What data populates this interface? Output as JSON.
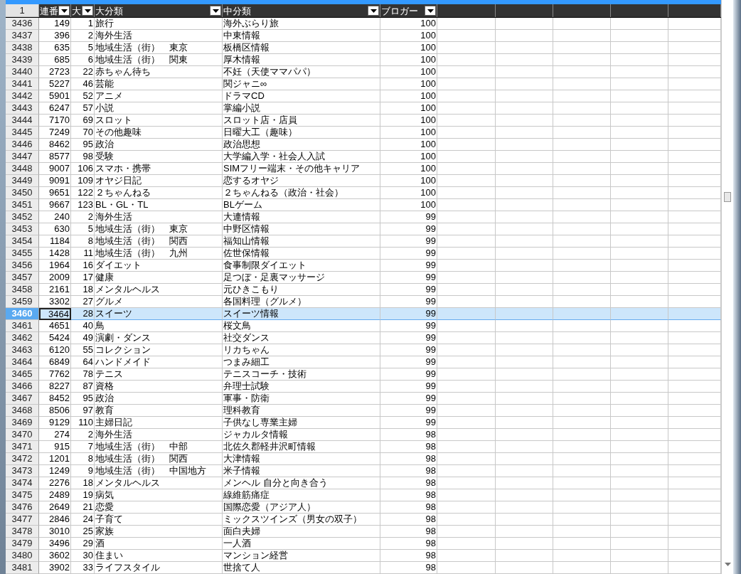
{
  "sheet": {
    "corner": "1",
    "columns": [
      {
        "label": "連番",
        "filter": true
      },
      {
        "label": "大",
        "filter": true
      },
      {
        "label": "大分類",
        "filter": true
      },
      {
        "label": "中分類",
        "filter": true
      },
      {
        "label": "ブロガー",
        "filter": true
      }
    ],
    "rows": [
      {
        "number": "3436",
        "cells": [
          "149",
          "1",
          "旅行",
          "海外ぶらり旅",
          "100"
        ],
        "selected": false
      },
      {
        "number": "3437",
        "cells": [
          "396",
          "2",
          "海外生活",
          "中東情報",
          "100"
        ],
        "selected": false
      },
      {
        "number": "3438",
        "cells": [
          "635",
          "5",
          "地域生活（街）　東京",
          "板橋区情報",
          "100"
        ],
        "selected": false
      },
      {
        "number": "3439",
        "cells": [
          "685",
          "6",
          "地域生活（街）　関東",
          "厚木情報",
          "100"
        ],
        "selected": false
      },
      {
        "number": "3440",
        "cells": [
          "2723",
          "22",
          "赤ちゃん待ち",
          "不妊（天使ママパパ）",
          "100"
        ],
        "selected": false
      },
      {
        "number": "3441",
        "cells": [
          "5227",
          "46",
          "芸能",
          "関ジャニ∞",
          "100"
        ],
        "selected": false
      },
      {
        "number": "3442",
        "cells": [
          "5901",
          "52",
          "アニメ",
          "ドラマCD",
          "100"
        ],
        "selected": false
      },
      {
        "number": "3443",
        "cells": [
          "6247",
          "57",
          "小説",
          "掌編小説",
          "100"
        ],
        "selected": false
      },
      {
        "number": "3444",
        "cells": [
          "7170",
          "69",
          "スロット",
          "スロット店・店員",
          "100"
        ],
        "selected": false
      },
      {
        "number": "3445",
        "cells": [
          "7249",
          "70",
          "その他趣味",
          "日曜大工（趣味）",
          "100"
        ],
        "selected": false
      },
      {
        "number": "3446",
        "cells": [
          "8462",
          "95",
          "政治",
          "政治思想",
          "100"
        ],
        "selected": false
      },
      {
        "number": "3447",
        "cells": [
          "8577",
          "98",
          "受験",
          "大学編入学・社会人入試",
          "100"
        ],
        "selected": false
      },
      {
        "number": "3448",
        "cells": [
          "9007",
          "106",
          "スマホ・携帯",
          "SIMフリー端末・その他キャリア",
          "100"
        ],
        "selected": false
      },
      {
        "number": "3449",
        "cells": [
          "9091",
          "109",
          "オヤジ日記",
          "恋するオヤジ",
          "100"
        ],
        "selected": false
      },
      {
        "number": "3450",
        "cells": [
          "9651",
          "122",
          "２ちゃんねる",
          "２ちゃんねる（政治・社会）",
          "100"
        ],
        "selected": false
      },
      {
        "number": "3451",
        "cells": [
          "9667",
          "123",
          "BL・GL・TL",
          "BLゲーム",
          "100"
        ],
        "selected": false
      },
      {
        "number": "3452",
        "cells": [
          "240",
          "2",
          "海外生活",
          "大連情報",
          "99"
        ],
        "selected": false
      },
      {
        "number": "3453",
        "cells": [
          "630",
          "5",
          "地域生活（街）　東京",
          "中野区情報",
          "99"
        ],
        "selected": false
      },
      {
        "number": "3454",
        "cells": [
          "1184",
          "8",
          "地域生活（街）　関西",
          "福知山情報",
          "99"
        ],
        "selected": false
      },
      {
        "number": "3455",
        "cells": [
          "1428",
          "11",
          "地域生活（街）　九州",
          "佐世保情報",
          "99"
        ],
        "selected": false
      },
      {
        "number": "3456",
        "cells": [
          "1964",
          "16",
          "ダイエット",
          "食事制限ダイエット",
          "99"
        ],
        "selected": false
      },
      {
        "number": "3457",
        "cells": [
          "2009",
          "17",
          "健康",
          "足つぼ・足裏マッサージ",
          "99"
        ],
        "selected": false
      },
      {
        "number": "3458",
        "cells": [
          "2161",
          "18",
          "メンタルヘルス",
          "元ひきこもり",
          "99"
        ],
        "selected": false
      },
      {
        "number": "3459",
        "cells": [
          "3302",
          "27",
          "グルメ",
          "各国料理（グルメ）",
          "99"
        ],
        "selected": false
      },
      {
        "number": "3460",
        "cells": [
          "3464",
          "28",
          "スイーツ",
          "スイーツ情報",
          "99"
        ],
        "selected": true
      },
      {
        "number": "3461",
        "cells": [
          "4651",
          "40",
          "鳥",
          "桜文鳥",
          "99"
        ],
        "selected": false
      },
      {
        "number": "3462",
        "cells": [
          "5424",
          "49",
          "演劇・ダンス",
          "社交ダンス",
          "99"
        ],
        "selected": false
      },
      {
        "number": "3463",
        "cells": [
          "6120",
          "55",
          "コレクション",
          "リカちゃん",
          "99"
        ],
        "selected": false
      },
      {
        "number": "3464",
        "cells": [
          "6849",
          "64",
          "ハンドメイド",
          "つまみ細工",
          "99"
        ],
        "selected": false
      },
      {
        "number": "3465",
        "cells": [
          "7762",
          "78",
          "テニス",
          "テニスコーチ・技術",
          "99"
        ],
        "selected": false
      },
      {
        "number": "3466",
        "cells": [
          "8227",
          "87",
          "資格",
          "弁理士試験",
          "99"
        ],
        "selected": false
      },
      {
        "number": "3467",
        "cells": [
          "8452",
          "95",
          "政治",
          "軍事・防衛",
          "99"
        ],
        "selected": false
      },
      {
        "number": "3468",
        "cells": [
          "8506",
          "97",
          "教育",
          "理科教育",
          "99"
        ],
        "selected": false
      },
      {
        "number": "3469",
        "cells": [
          "9129",
          "110",
          "主婦日記",
          "子供なし専業主婦",
          "99"
        ],
        "selected": false
      },
      {
        "number": "3470",
        "cells": [
          "274",
          "2",
          "海外生活",
          "ジャカルタ情報",
          "98"
        ],
        "selected": false
      },
      {
        "number": "3471",
        "cells": [
          "915",
          "7",
          "地域生活（街）　中部",
          "北佐久郡軽井沢町情報",
          "98"
        ],
        "selected": false
      },
      {
        "number": "3472",
        "cells": [
          "1201",
          "8",
          "地域生活（街）　関西",
          "大津情報",
          "98"
        ],
        "selected": false
      },
      {
        "number": "3473",
        "cells": [
          "1249",
          "9",
          "地域生活（街）　中国地方",
          "米子情報",
          "98"
        ],
        "selected": false
      },
      {
        "number": "3474",
        "cells": [
          "2276",
          "18",
          "メンタルヘルス",
          "メンヘル 自分と向き合う",
          "98"
        ],
        "selected": false
      },
      {
        "number": "3475",
        "cells": [
          "2489",
          "19",
          "病気",
          "線維筋痛症",
          "98"
        ],
        "selected": false
      },
      {
        "number": "3476",
        "cells": [
          "2649",
          "21",
          "恋愛",
          "国際恋愛（アジア人）",
          "98"
        ],
        "selected": false
      },
      {
        "number": "3477",
        "cells": [
          "2846",
          "24",
          "子育て",
          "ミックスツインズ（男女の双子）",
          "98"
        ],
        "selected": false
      },
      {
        "number": "3478",
        "cells": [
          "3010",
          "25",
          "家族",
          "面白夫婦",
          "98"
        ],
        "selected": false
      },
      {
        "number": "3479",
        "cells": [
          "3496",
          "29",
          "酒",
          "一人酒",
          "98"
        ],
        "selected": false
      },
      {
        "number": "3480",
        "cells": [
          "3602",
          "30",
          "住まい",
          "マンション経営",
          "98"
        ],
        "selected": false
      },
      {
        "number": "3481",
        "cells": [
          "3902",
          "33",
          "ライフスタイル",
          "世捨て人",
          "98"
        ],
        "selected": false
      }
    ]
  }
}
